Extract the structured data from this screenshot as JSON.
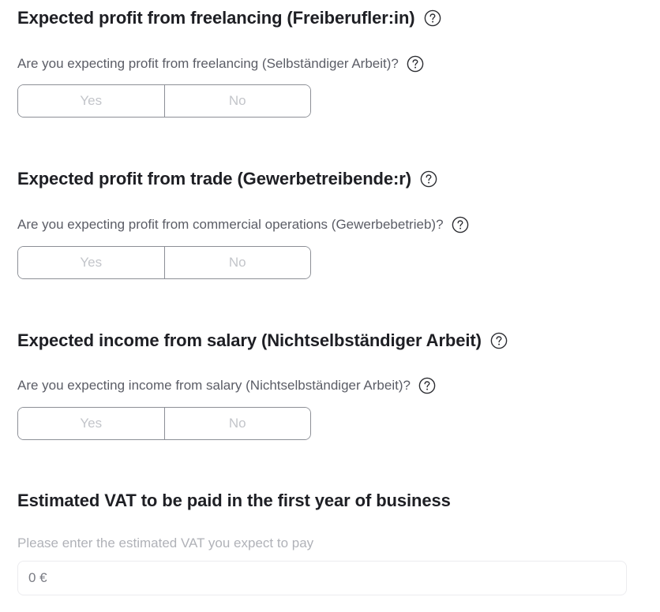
{
  "help_icon": "question-circle-icon",
  "colors": {
    "heading": "#1e1f24",
    "question_text": "#5b5d66",
    "toggle_border": "#8c8f96",
    "toggle_text": "#c3c5ca",
    "vat_label": "#b0b2b8",
    "input_border": "#ececef"
  },
  "freelancing": {
    "heading": "Expected profit from freelancing (Freiberufler:in)",
    "question": "Are you expecting profit from freelancing (Selbständiger Arbeit)?",
    "yes_label": "Yes",
    "no_label": "No"
  },
  "trade": {
    "heading": "Expected profit from trade (Gewerbetreibende:r)",
    "question": "Are you expecting profit from commercial operations (Gewerbebetrieb)?",
    "yes_label": "Yes",
    "no_label": "No"
  },
  "salary": {
    "heading": "Expected income from salary (Nichtselbständiger Arbeit)",
    "question": "Are you expecting income from salary (Nichtselbständiger Arbeit)?",
    "yes_label": "Yes",
    "no_label": "No"
  },
  "vat": {
    "heading": "Estimated VAT to be paid in the first year of business",
    "label": "Please enter the estimated VAT you expect to pay",
    "value": "0 €"
  }
}
